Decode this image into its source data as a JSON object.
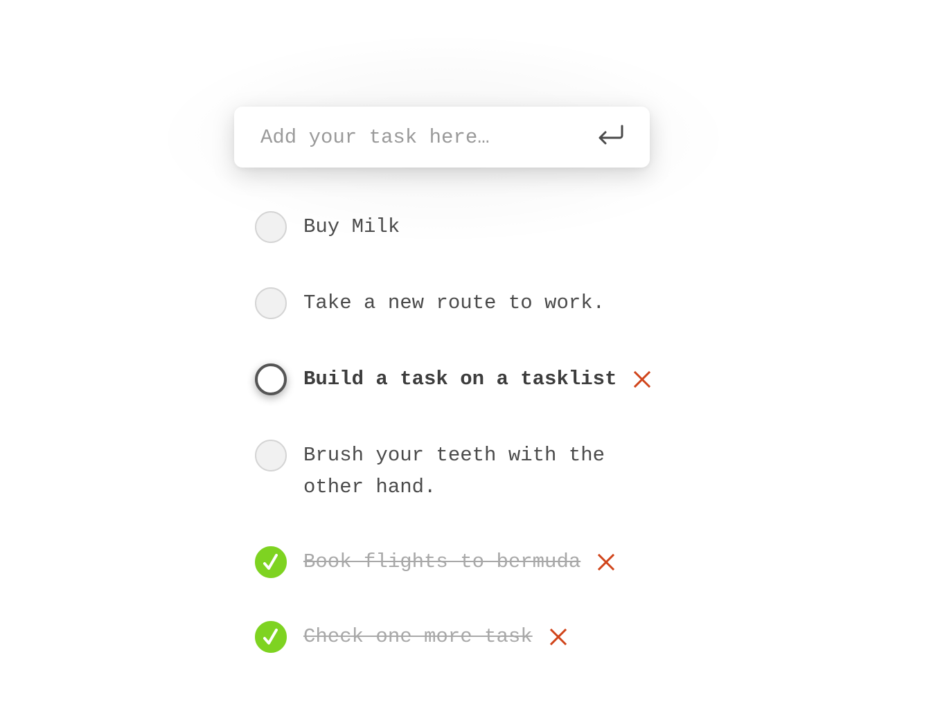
{
  "input": {
    "placeholder": "Add your task here…",
    "value": "",
    "submit_icon": "enter-return-icon"
  },
  "tasks": [
    {
      "label": "Buy Milk",
      "state": "open"
    },
    {
      "label": "Take a new route to work.",
      "state": "open"
    },
    {
      "label": "Build a task on a tasklist",
      "state": "hovered",
      "delete_icon": "close-x-icon"
    },
    {
      "label": "Brush your teeth with the other hand.",
      "state": "open"
    },
    {
      "label": "Book flights to bermuda",
      "state": "done",
      "delete_icon": "close-x-icon"
    },
    {
      "label": "Check one more task",
      "state": "done",
      "delete_icon": "close-x-icon"
    }
  ],
  "colors": {
    "done_green": "#7ed321",
    "delete_red": "#d0441a",
    "text": "#4a4a4a",
    "completed_text": "#a8a8a8"
  }
}
